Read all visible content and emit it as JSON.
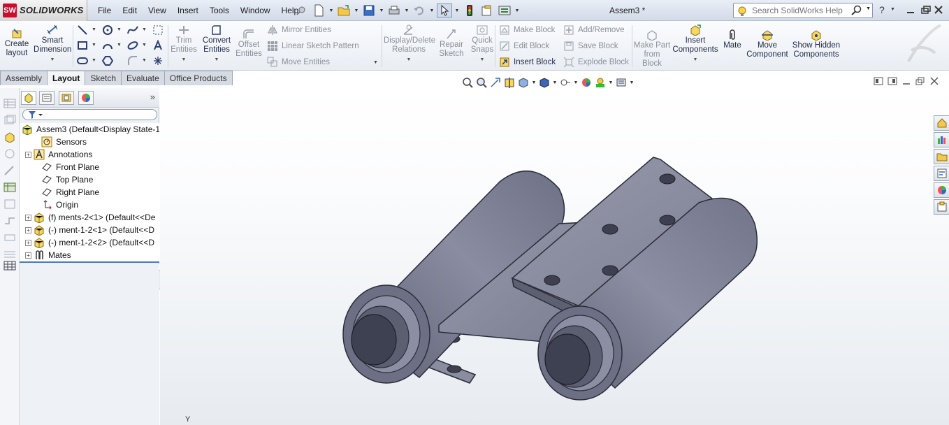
{
  "app": {
    "brand": "SOLIDWORKS",
    "brand_mark": "SW",
    "doc_title": "Assem3 *"
  },
  "menu": [
    "File",
    "Edit",
    "View",
    "Insert",
    "Tools",
    "Window",
    "Help"
  ],
  "search": {
    "placeholder": "Search SolidWorks Help"
  },
  "help_label": "?",
  "toolbar": {
    "create_layout": "Create layout",
    "smart_dimension": "Smart Dimension",
    "trim_entities": "Trim Entities",
    "convert_entities": "Convert Entities",
    "offset_entities": "Offset Entities",
    "mirror_entities": "Mirror Entities",
    "linear_sketch_pattern": "Linear Sketch Pattern",
    "move_entities": "Move Entities",
    "display_delete_relations": "Display/Delete Relations",
    "repair_sketch": "Repair Sketch",
    "quick_snaps": "Quick Snaps",
    "make_block": "Make Block",
    "edit_block": "Edit Block",
    "insert_block": "Insert Block",
    "add_remove": "Add/Remove",
    "save_block": "Save Block",
    "explode_block": "Explode Block",
    "make_part_from_block": "Make Part from Block",
    "insert_components": "Insert Components",
    "mate": "Mate",
    "move_component": "Move Component",
    "show_hidden_components": "Show Hidden Components"
  },
  "tabs": [
    {
      "label": "Assembly",
      "active": false
    },
    {
      "label": "Layout",
      "active": true
    },
    {
      "label": "Sketch",
      "active": false
    },
    {
      "label": "Evaluate",
      "active": false
    },
    {
      "label": "Office Products",
      "active": false
    }
  ],
  "fm": {
    "expand_symbol": "»",
    "tree": [
      {
        "label": "Assem3  (Default<Display State-1",
        "icon": "assembly-icon",
        "expand": "none",
        "indent": 0
      },
      {
        "label": "Sensors",
        "icon": "sensors-icon",
        "expand": "none",
        "indent": 1
      },
      {
        "label": "Annotations",
        "icon": "annotations-icon",
        "expand": "plus",
        "indent": 1
      },
      {
        "label": "Front Plane",
        "icon": "plane-icon",
        "expand": "none",
        "indent": 1
      },
      {
        "label": "Top Plane",
        "icon": "plane-icon",
        "expand": "none",
        "indent": 1
      },
      {
        "label": "Right Plane",
        "icon": "plane-icon",
        "expand": "none",
        "indent": 1
      },
      {
        "label": "Origin",
        "icon": "origin-icon",
        "expand": "none",
        "indent": 1
      },
      {
        "label": "(f) ments-2<1> (Default<<De",
        "icon": "subassembly-icon",
        "expand": "plus",
        "indent": 1
      },
      {
        "label": "(-) ment-1-2<1> (Default<<D",
        "icon": "subassembly-icon",
        "expand": "plus",
        "indent": 1
      },
      {
        "label": "(-) ment-1-2<2> (Default<<D",
        "icon": "subassembly-icon",
        "expand": "plus",
        "indent": 1
      },
      {
        "label": "Mates",
        "icon": "mates-icon",
        "expand": "plus",
        "indent": 1
      }
    ]
  },
  "graphics": {
    "axis_label": "Y"
  },
  "colors": {
    "accent": "#4f78b6",
    "model_fill": "#7b7e92",
    "model_dark": "#4d5064",
    "brand_red": "#c8102e"
  }
}
